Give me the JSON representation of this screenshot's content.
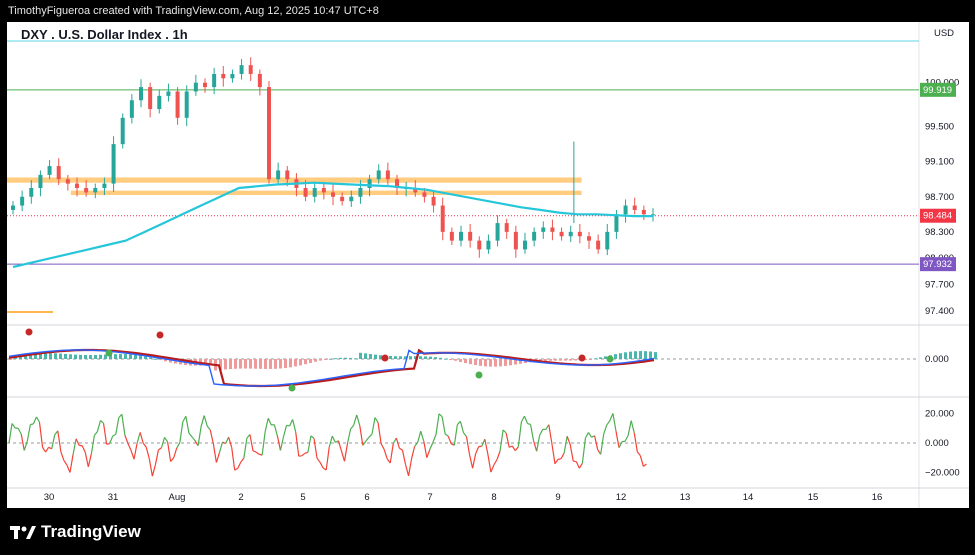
{
  "header": {
    "credit": "TimothyFigueroa created with TradingView.com, Aug 12, 2025 10:47 UTC+8"
  },
  "chart_title": "DXY . U.S. Dollar Index . 1h",
  "currency": "USD",
  "footer": {
    "brand": "TradingView"
  },
  "colors": {
    "up": "#26a69a",
    "down": "#ef5350",
    "ema": "#26c6da",
    "zone": "#ffcc80",
    "green_line": "#4caf50",
    "purple_line": "#7e57c2",
    "red_tag": "#f23645",
    "macd": "#2962ff",
    "signal_red": "#b71c1c",
    "signal_green": "#4caf50",
    "osc_up": "#4caf50",
    "osc_down": "#f44336"
  },
  "chart_data": {
    "type": "line",
    "price_axis": {
      "ticks": [
        "100.000",
        "99.500",
        "99.100",
        "98.700",
        "98.300",
        "98.000",
        "97.700",
        "97.400"
      ],
      "ylim": [
        97.25,
        100.35
      ]
    },
    "date_axis": [
      "30",
      "31",
      "Aug",
      "2",
      "5",
      "6",
      "7",
      "8",
      "9",
      "12",
      "13",
      "14",
      "15",
      "16"
    ],
    "price_tags": [
      {
        "label": "99.919",
        "value": 99.919,
        "color": "#4caf50"
      },
      {
        "label": "98.484",
        "value": 98.484,
        "color": "#f23645"
      },
      {
        "label": "97.932",
        "value": 97.932,
        "color": "#7e57c2"
      }
    ],
    "horizontal_lines": [
      {
        "value": 99.919,
        "color": "#4caf50"
      },
      {
        "value": 97.932,
        "color": "#7e57c2"
      },
      {
        "value": 98.484,
        "color": "#f23645",
        "dotted": true
      }
    ],
    "zones": [
      {
        "from": 98.86,
        "to": 98.92,
        "x_from": 0,
        "x_to": 0.63
      },
      {
        "from": 98.72,
        "to": 98.77,
        "x_from": 0.07,
        "x_to": 0.63
      }
    ],
    "close_series": [
      98.6,
      98.7,
      98.8,
      98.95,
      99.05,
      98.9,
      98.85,
      98.8,
      98.75,
      98.8,
      98.85,
      99.3,
      99.6,
      99.8,
      99.95,
      99.7,
      99.85,
      99.9,
      99.6,
      99.9,
      100.0,
      99.95,
      100.1,
      100.05,
      100.1,
      100.2,
      100.1,
      99.95,
      98.9,
      99.0,
      98.9,
      98.8,
      98.7,
      98.8,
      98.75,
      98.7,
      98.65,
      98.7,
      98.8,
      98.9,
      99.0,
      98.9,
      98.8,
      98.8,
      98.75,
      98.7,
      98.6,
      98.3,
      98.2,
      98.3,
      98.2,
      98.1,
      98.2,
      98.4,
      98.3,
      98.1,
      98.2,
      98.3,
      98.35,
      98.3,
      98.25,
      98.3,
      98.25,
      98.2,
      98.1,
      98.3,
      98.5,
      98.6,
      98.55,
      98.5,
      98.5
    ],
    "ema_series": [
      97.9,
      97.95,
      98.0,
      98.05,
      98.1,
      98.15,
      98.2,
      98.3,
      98.4,
      98.5,
      98.6,
      98.7,
      98.8,
      98.82,
      98.84,
      98.85,
      98.86,
      98.85,
      98.84,
      98.83,
      98.82,
      98.8,
      98.78,
      98.74,
      98.7,
      98.66,
      98.62,
      98.58,
      98.55,
      98.52,
      98.5,
      98.5,
      98.49,
      98.48,
      98.48
    ],
    "macd_panel": {
      "ticks": [
        "0.000"
      ]
    },
    "oscillator_panel": {
      "ticks": [
        "20.000",
        "0.000",
        "−20.000"
      ],
      "ylim": [
        -28,
        28
      ]
    }
  }
}
